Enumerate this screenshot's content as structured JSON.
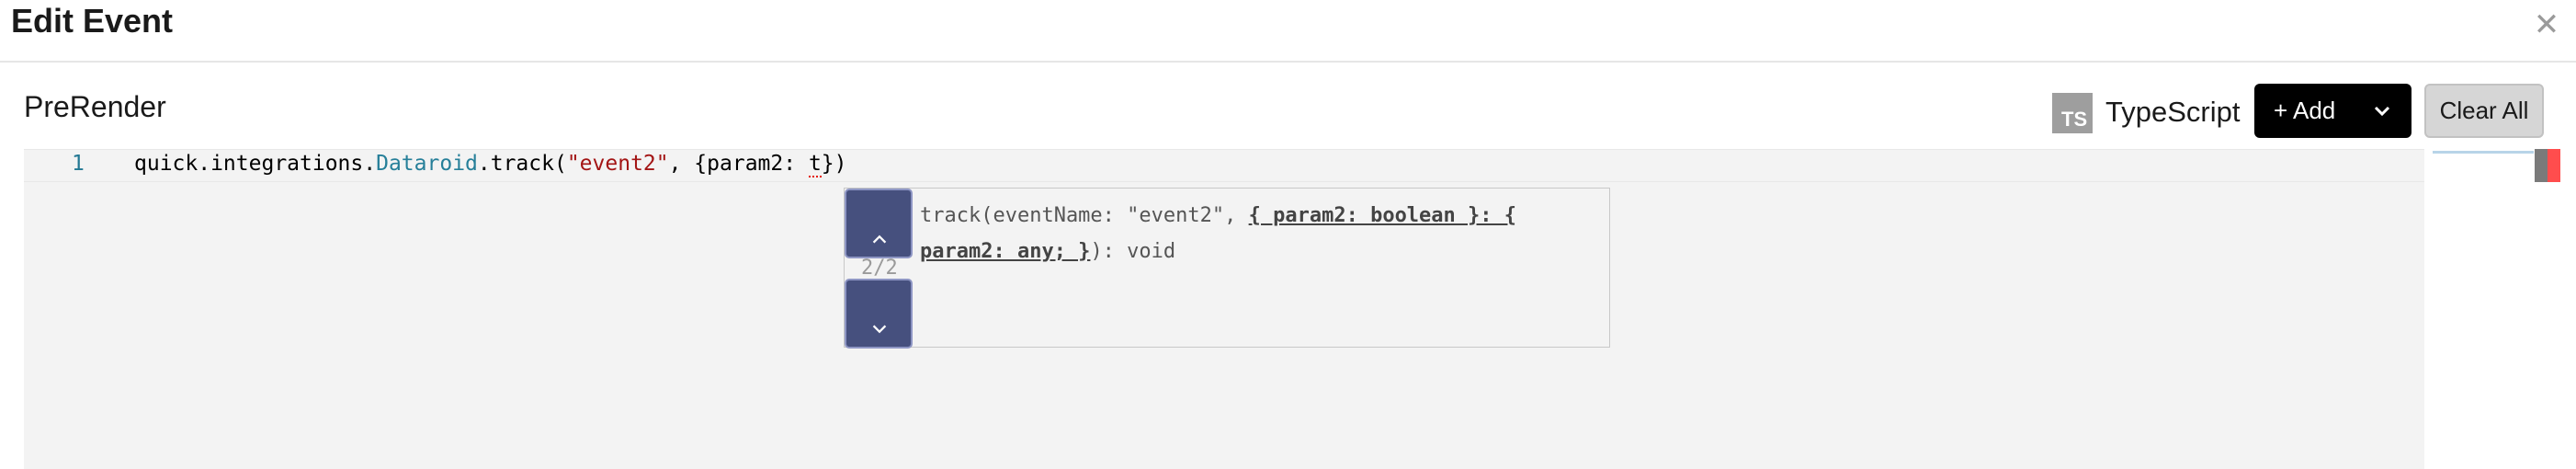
{
  "dialog": {
    "title": "Edit Event",
    "close_icon": "close-icon"
  },
  "section": {
    "title": "PreRender"
  },
  "toolbar": {
    "lang_badge": "TS",
    "language": "TypeScript",
    "add_label": "+ Add",
    "add_dropdown_icon": "chevron-down-icon",
    "clear_label": "Clear All"
  },
  "editor": {
    "line_number": "1",
    "code": {
      "prefix": "quick.integrations.",
      "class_name": "Dataroid",
      "method": ".track(",
      "string_arg": "\"event2\"",
      "after_string": ", {param2: ",
      "error_token": "t",
      "suffix": "})"
    }
  },
  "parameter_hint": {
    "counter": "2/2",
    "signature_prefix": "track(eventName: \"event2\", ",
    "active_param": "{ param2: boolean }: {\nparam2: any; }",
    "signature_suffix": "): void",
    "prev_icon": "chevron-up-icon",
    "next_icon": "chevron-down-icon"
  },
  "colors": {
    "accent_button": "#000000",
    "class_token": "#267f99",
    "string_token": "#a31515",
    "line_number": "#237893",
    "hint_button": "#46507e",
    "error": "#e51400"
  }
}
